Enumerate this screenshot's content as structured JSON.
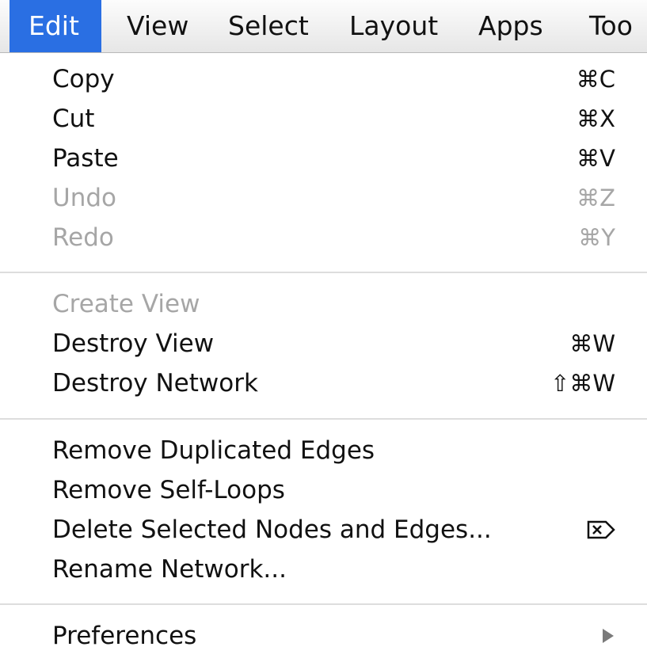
{
  "menubar": {
    "items": [
      {
        "label": "Edit",
        "active": true
      },
      {
        "label": "View"
      },
      {
        "label": "Select"
      },
      {
        "label": "Layout"
      },
      {
        "label": "Apps"
      },
      {
        "label": "Too"
      }
    ]
  },
  "menu": {
    "groups": [
      [
        {
          "label": "Copy",
          "shortcut": "⌘C",
          "enabled": true
        },
        {
          "label": "Cut",
          "shortcut": "⌘X",
          "enabled": true
        },
        {
          "label": "Paste",
          "shortcut": "⌘V",
          "enabled": true
        },
        {
          "label": "Undo",
          "shortcut": "⌘Z",
          "enabled": false
        },
        {
          "label": "Redo",
          "shortcut": "⌘Y",
          "enabled": false
        }
      ],
      [
        {
          "label": "Create View",
          "shortcut": "",
          "enabled": false
        },
        {
          "label": "Destroy View",
          "shortcut": "⌘W",
          "enabled": true
        },
        {
          "label": "Destroy Network",
          "shortcut": "⇧⌘W",
          "enabled": true
        }
      ],
      [
        {
          "label": "Remove Duplicated Edges",
          "shortcut": "",
          "enabled": true
        },
        {
          "label": "Remove Self-Loops",
          "shortcut": "",
          "enabled": true
        },
        {
          "label": "Delete Selected Nodes and Edges...",
          "shortcut_icon": "delete-key-icon",
          "enabled": true
        },
        {
          "label": "Rename Network...",
          "shortcut": "",
          "enabled": true
        }
      ],
      [
        {
          "label": "Preferences",
          "submenu": true,
          "enabled": true
        }
      ]
    ]
  },
  "colors": {
    "active_menu_bg": "#2a6fe3",
    "disabled_text": "#a6a6a6"
  }
}
